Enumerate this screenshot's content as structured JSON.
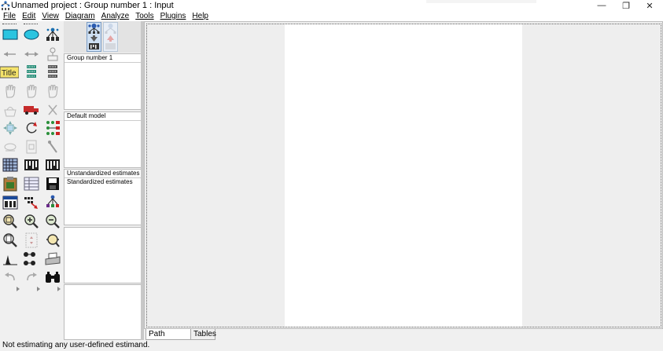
{
  "window": {
    "title": "Unnamed project : Group number 1 : Input",
    "controls": {
      "minimize": "—",
      "maximize": "❐",
      "close": "✕"
    }
  },
  "menu": [
    "File",
    "Edit",
    "View",
    "Diagram",
    "Analyze",
    "Tools",
    "Plugins",
    "Help"
  ],
  "palette": {
    "title_tool_label": "Title",
    "tools": [
      "draw-observed-variable",
      "draw-unobserved-variable",
      "draw-indicator-variable",
      "draw-path",
      "draw-covariance",
      "add-unique-variable",
      "figure-caption",
      "list-variables-in-model",
      "list-variables-in-dataset",
      "select-one-object",
      "select-all-objects",
      "deselect-all-objects",
      "duplicate-objects",
      "move-objects",
      "erase-objects",
      "change-shape",
      "rotate-indicators",
      "reflect-indicators",
      "move-parameter-values",
      "scroll",
      "touch-up",
      "select-data-files",
      "analysis-properties",
      "calculate-estimates",
      "copy-to-clipboard",
      "view-text",
      "save-diagram",
      "object-properties",
      "drag-properties",
      "preserve-symmetries",
      "zoom-in-area",
      "zoom-in",
      "zoom-out",
      "view-page",
      "fit-to-page",
      "loupe",
      "bayesian-estimation",
      "multiple-group-analysis",
      "print",
      "undo",
      "redo",
      "specification-search"
    ]
  },
  "mode_buttons": [
    "view-input-path-diagram",
    "view-output-path-diagram"
  ],
  "panels": {
    "groups": [
      "Group number 1"
    ],
    "models": [
      "Default model"
    ],
    "estimates": [
      "Unstandardized estimates",
      "Standardized estimates"
    ],
    "files": [],
    "computation_summary": []
  },
  "tabs": [
    "Path diagram",
    "Tables"
  ],
  "active_tab": "Path diagram",
  "status": "Not estimating any user-defined estimand."
}
